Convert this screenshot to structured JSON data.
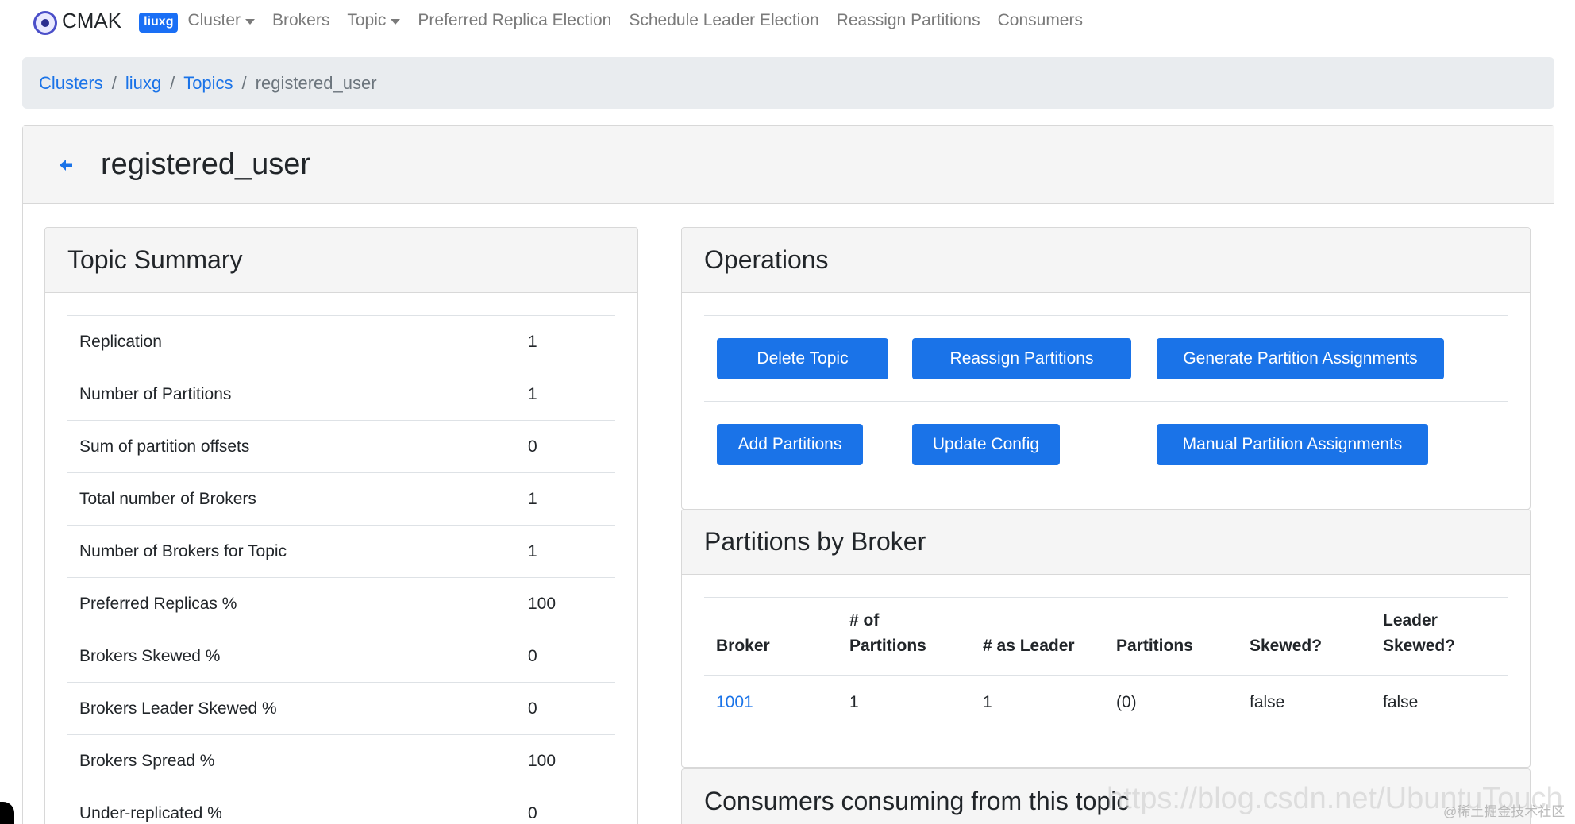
{
  "navbar": {
    "brand": "CMAK",
    "cluster_badge": "liuxg",
    "links": {
      "cluster": "Cluster",
      "brokers": "Brokers",
      "topic": "Topic",
      "preferred_replica_election": "Preferred Replica Election",
      "schedule_leader_election": "Schedule Leader Election",
      "reassign_partitions": "Reassign Partitions",
      "consumers": "Consumers"
    }
  },
  "breadcrumb": {
    "items": [
      "Clusters",
      "liuxg",
      "Topics"
    ],
    "separator": "/",
    "active": "registered_user"
  },
  "page": {
    "title": "registered_user",
    "back_icon": "arrow-left-icon"
  },
  "topic_summary": {
    "title": "Topic Summary",
    "rows": [
      {
        "label": "Replication",
        "value": "1"
      },
      {
        "label": "Number of Partitions",
        "value": "1"
      },
      {
        "label": "Sum of partition offsets",
        "value": "0"
      },
      {
        "label": "Total number of Brokers",
        "value": "1"
      },
      {
        "label": "Number of Brokers for Topic",
        "value": "1"
      },
      {
        "label": "Preferred Replicas %",
        "value": "100"
      },
      {
        "label": "Brokers Skewed %",
        "value": "0"
      },
      {
        "label": "Brokers Leader Skewed %",
        "value": "0"
      },
      {
        "label": "Brokers Spread %",
        "value": "100"
      },
      {
        "label": "Under-replicated %",
        "value": "0"
      }
    ]
  },
  "operations": {
    "title": "Operations",
    "delete_topic": "Delete Topic",
    "reassign_partitions": "Reassign Partitions",
    "generate_partition_assignments": "Generate Partition Assignments",
    "add_partitions": "Add Partitions",
    "update_config": "Update Config",
    "manual_partition_assignments": "Manual Partition Assignments"
  },
  "partitions_by_broker": {
    "title": "Partitions by Broker",
    "headers": {
      "broker": "Broker",
      "num_partitions_1": "# of",
      "num_partitions_2": "Partitions",
      "as_leader": "# as Leader",
      "partitions": "Partitions",
      "skewed": "Skewed?",
      "leader_skewed_1": "Leader",
      "leader_skewed_2": "Skewed?"
    },
    "rows": [
      {
        "broker": "1001",
        "num_partitions": "1",
        "as_leader": "1",
        "partitions": "(0)",
        "skewed": "false",
        "leader_skewed": "false"
      }
    ]
  },
  "consumers": {
    "title": "Consumers consuming from this topic"
  },
  "watermark": {
    "url": "https://blog.csdn.net/UbuntuTouch",
    "site": "@稀土掘金技术社区"
  },
  "colors": {
    "primary": "#1a73e8",
    "badge": "#1a6ff5",
    "breadcrumb_bg": "#e9ecef",
    "card_header_bg": "#f5f5f5"
  }
}
